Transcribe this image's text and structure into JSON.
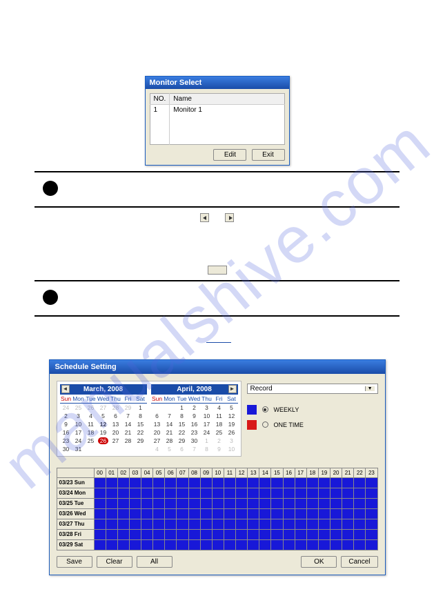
{
  "watermark": "manualshive.com",
  "monitor_dialog": {
    "title": "Monitor Select",
    "col_no": "NO.",
    "col_name": "Name",
    "rows": [
      {
        "no": "1",
        "name": "Monitor 1"
      }
    ],
    "edit": "Edit",
    "exit": "Exit"
  },
  "sched_dialog": {
    "title": "Schedule Setting",
    "month_left": "March, 2008",
    "month_right": "April, 2008",
    "weekdays": [
      "Sun",
      "Mon",
      "Tue",
      "Wed",
      "Thu",
      "Fri",
      "Sat"
    ],
    "left_grid": [
      [
        "24",
        "25",
        "26",
        "27",
        "28",
        "29",
        "1"
      ],
      [
        "2",
        "3",
        "4",
        "5",
        "6",
        "7",
        "8"
      ],
      [
        "9",
        "10",
        "11",
        "12",
        "13",
        "14",
        "15"
      ],
      [
        "16",
        "17",
        "18",
        "19",
        "20",
        "21",
        "22"
      ],
      [
        "23",
        "24",
        "25",
        "26",
        "27",
        "28",
        "29"
      ],
      [
        "30",
        "31",
        "",
        "",
        "",
        "",
        ""
      ]
    ],
    "left_dim": [
      [
        0,
        0
      ],
      [
        0,
        1
      ],
      [
        0,
        2
      ],
      [
        0,
        3
      ],
      [
        0,
        4
      ],
      [
        0,
        5
      ]
    ],
    "left_bold": [
      [
        2,
        3
      ]
    ],
    "left_today": [
      4,
      3
    ],
    "right_grid": [
      [
        "",
        "",
        "1",
        "2",
        "3",
        "4",
        "5"
      ],
      [
        "6",
        "7",
        "8",
        "9",
        "10",
        "11",
        "12"
      ],
      [
        "13",
        "14",
        "15",
        "16",
        "17",
        "18",
        "19"
      ],
      [
        "20",
        "21",
        "22",
        "23",
        "24",
        "25",
        "26"
      ],
      [
        "27",
        "28",
        "29",
        "30",
        "1",
        "2",
        "3"
      ],
      [
        "4",
        "5",
        "6",
        "7",
        "8",
        "9",
        "10"
      ]
    ],
    "right_dim": [
      [
        4,
        4
      ],
      [
        4,
        5
      ],
      [
        4,
        6
      ],
      [
        5,
        0
      ],
      [
        5,
        1
      ],
      [
        5,
        2
      ],
      [
        5,
        3
      ],
      [
        5,
        4
      ],
      [
        5,
        5
      ],
      [
        5,
        6
      ]
    ],
    "combo": "Record",
    "legend_weekly": "WEEKLY",
    "legend_onetime": "ONE TIME",
    "hours": [
      "00",
      "01",
      "02",
      "03",
      "04",
      "05",
      "06",
      "07",
      "08",
      "09",
      "10",
      "11",
      "12",
      "13",
      "14",
      "15",
      "16",
      "17",
      "18",
      "19",
      "20",
      "21",
      "22",
      "23"
    ],
    "days": [
      "03/23 Sun",
      "03/24 Mon",
      "03/25 Tue",
      "03/26 Wed",
      "03/27 Thu",
      "03/28 Fri",
      "03/29 Sat"
    ],
    "btn_save": "Save",
    "btn_clear": "Clear",
    "btn_all": "All",
    "btn_ok": "OK",
    "btn_cancel": "Cancel"
  }
}
